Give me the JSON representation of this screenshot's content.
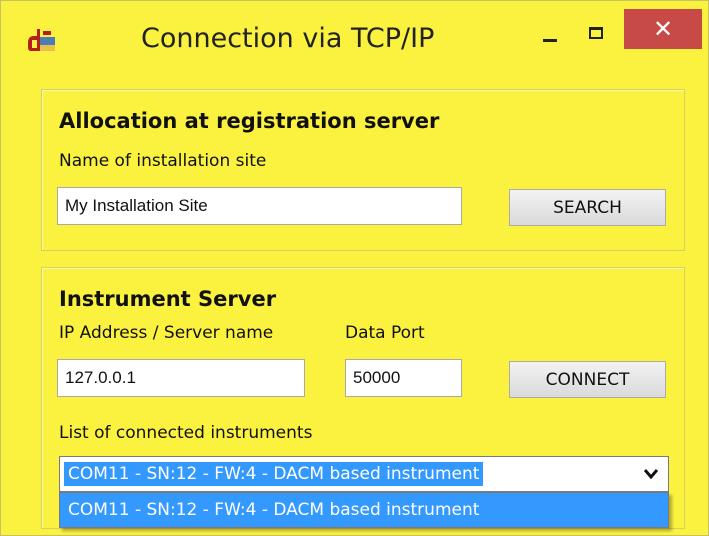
{
  "window": {
    "title": "Connection via TCP/IP",
    "close_symbol": "✕",
    "colors": {
      "background": "#fbf23f",
      "close": "#c74a46",
      "selection": "#3399ff"
    }
  },
  "registration": {
    "title": "Allocation at registration server",
    "site_label": "Name of installation site",
    "site_value": "My Installation Site",
    "search_label": "SEARCH"
  },
  "instrument_server": {
    "title": "Instrument Server",
    "ip_label": "IP Address / Server name",
    "ip_value": "127.0.0.1",
    "port_label": "Data Port",
    "port_value": "50000",
    "connect_label": "CONNECT",
    "list_label": "List of connected instruments",
    "selected_instrument": "COM11 - SN:12 - FW:4 - DACM based instrument",
    "options": [
      "COM11 - SN:12 - FW:4 - DACM based instrument"
    ]
  },
  "icons": {
    "app": "app-logo-icon",
    "minimize": "minimize-icon",
    "maximize": "maximize-icon",
    "close": "close-icon",
    "dropdown": "chevron-down-icon"
  }
}
